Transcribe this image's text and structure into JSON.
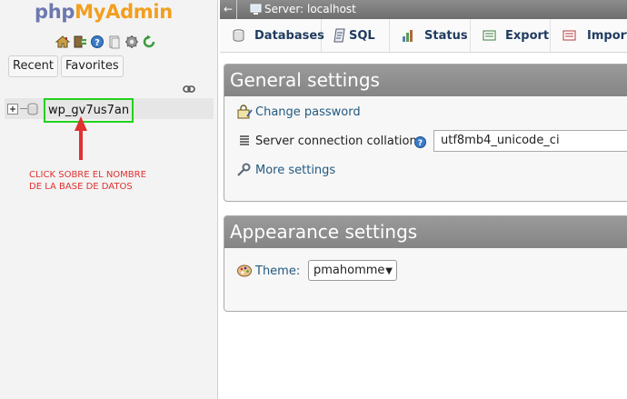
{
  "nav": {
    "logo_php": "php",
    "logo_admin": "MyAdmin",
    "icons": [
      "home-icon",
      "logout-icon",
      "help-icon",
      "docs-icon",
      "settings-icon",
      "reload-icon"
    ],
    "tabs": [
      "Recent",
      "Favorites"
    ],
    "database": "wp_gv7us7an",
    "instruction_line1": "CLICK SOBRE EL NOMBRE",
    "instruction_line2": "DE LA BASE DE DATOS"
  },
  "topbar": {
    "back": "←",
    "server": "Server: localhost"
  },
  "menu": {
    "tabs": [
      "Databases",
      "SQL",
      "Status",
      "Export",
      "Import"
    ]
  },
  "general": {
    "title": "General settings",
    "change_password": "Change password",
    "collation_label": "Server connection collation:",
    "collation_value": "utf8mb4_unicode_ci",
    "more_settings": "More settings"
  },
  "appearance": {
    "title": "Appearance settings",
    "theme_label": "Theme:",
    "theme_value": "pmahomme"
  },
  "colors": {
    "accent_link": "#235a81",
    "highlight_border": "#23d11d",
    "annotation_red": "#e03131",
    "logo_php": "#6c78af",
    "logo_admin": "#f29e1f"
  }
}
